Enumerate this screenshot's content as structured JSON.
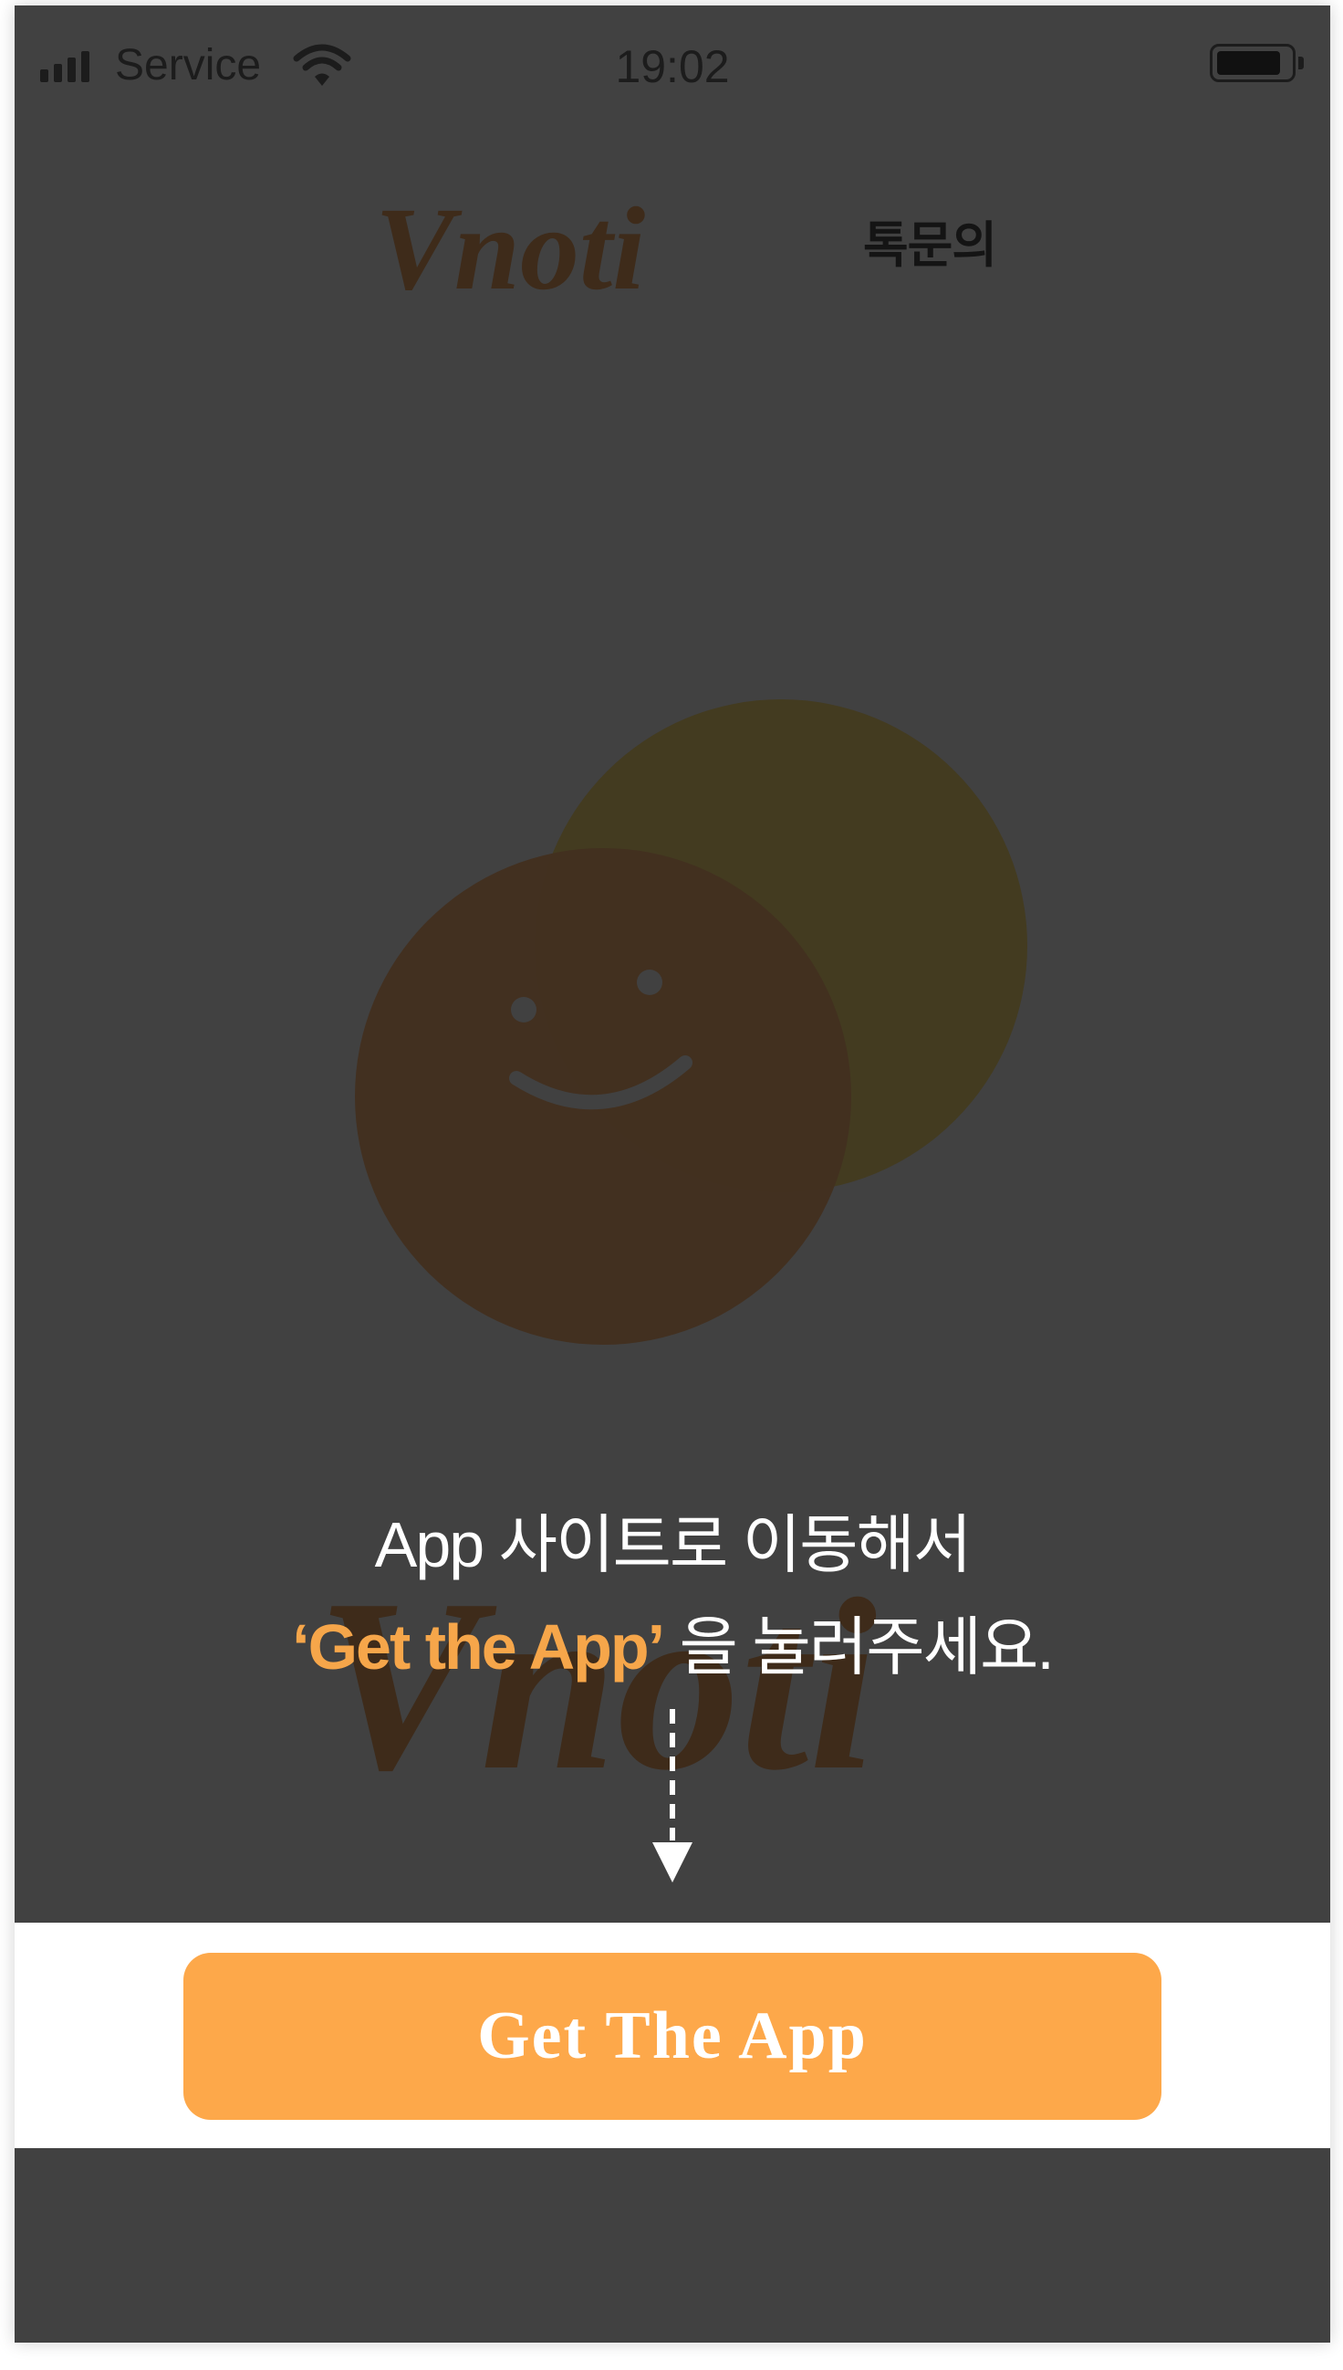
{
  "status_bar": {
    "carrier": "Service",
    "time": "19:02",
    "battery_level": 0.9
  },
  "header": {
    "logo_text": "Vnoti",
    "inquiry_label": "톡문의"
  },
  "instruction": {
    "line1": "App 사이트로 이동해서",
    "line2_highlight": "‘Get the App’",
    "line2_rest": " 을 눌러주세요."
  },
  "watermark_logo_text": "Vnoti",
  "button": {
    "label": "Get The App"
  },
  "colors": {
    "overlay": "#414141",
    "accent": "#fda84a",
    "highlight_text": "#f6a64a",
    "smiley_orange": "#43301f",
    "smiley_yellow": "#433b20"
  },
  "icons": [
    "signal-icon",
    "wifi-icon",
    "battery-icon",
    "smiley-logo-icon",
    "down-arrow-icon"
  ]
}
